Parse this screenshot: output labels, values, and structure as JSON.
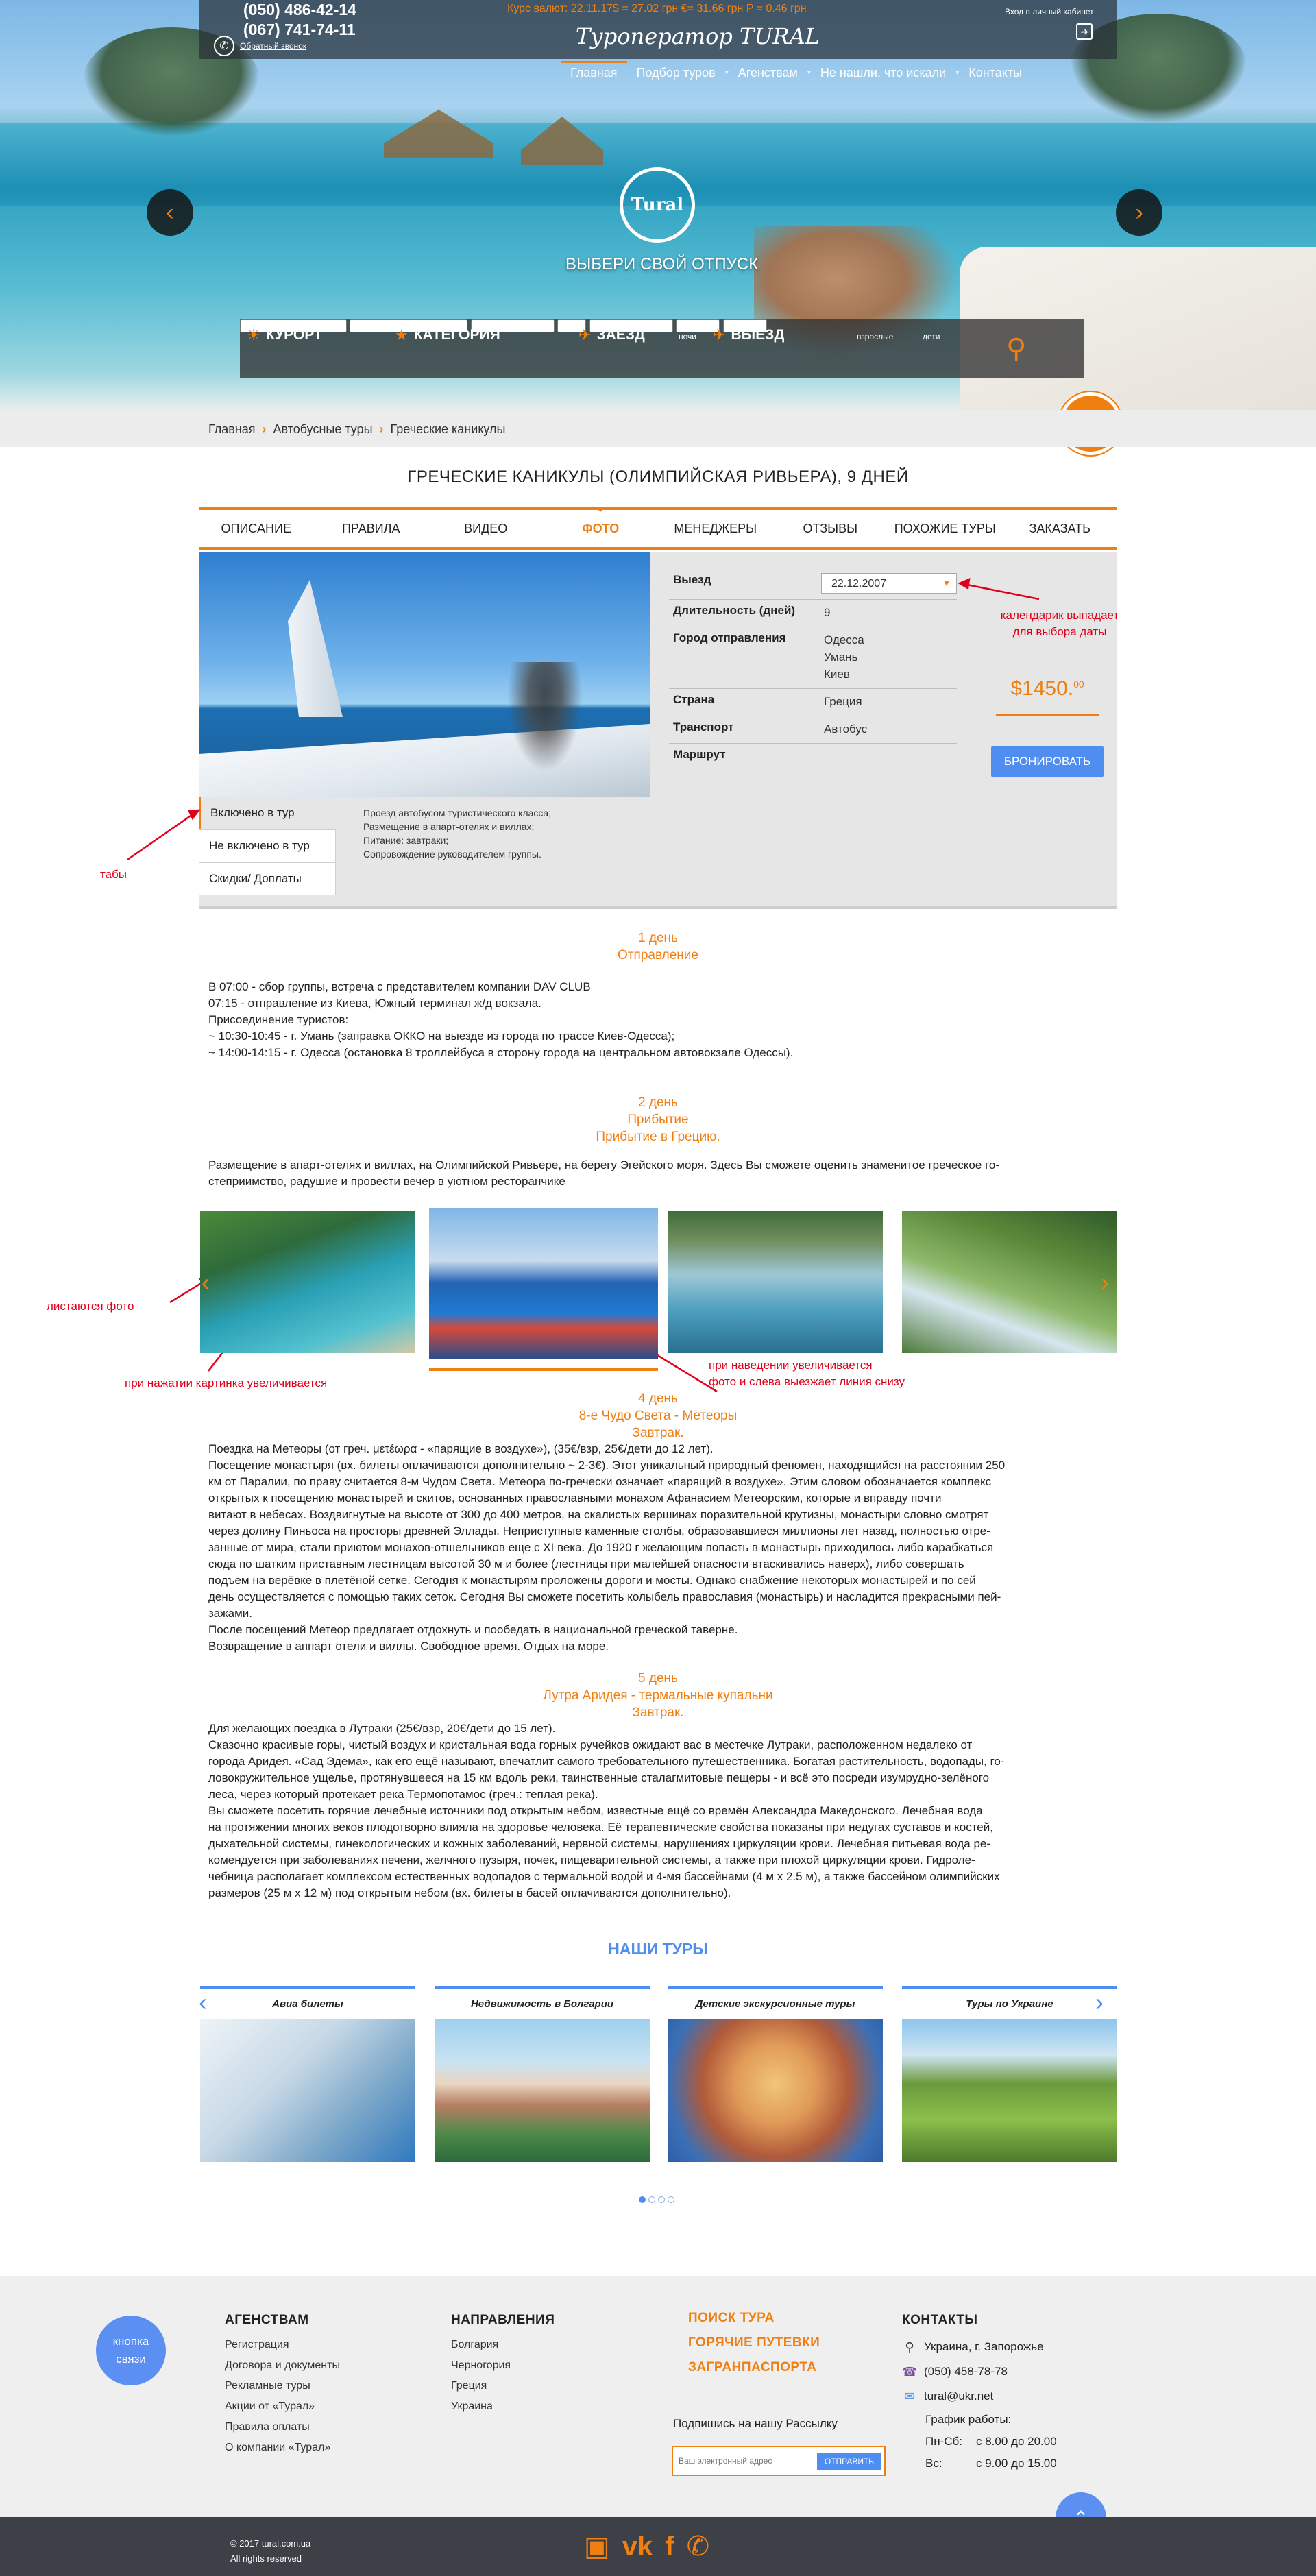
{
  "header": {
    "phones": [
      "(050) 486-42-14",
      "(067) 741-74-11"
    ],
    "callback_label": "Обратный звонок",
    "rate": "Курс валют: 22.11.17$ = 27.02 грн €= 31.66 грн P = 0.46 грн",
    "brand": "Туроператор TURAL",
    "login": "Вход в личный кабинет",
    "login_icon": "exit-icon",
    "nav": [
      "Главная",
      "Подбор туров",
      "Агенствам",
      "Не нашли, что искали",
      "Контакты"
    ],
    "active_nav": "Главная"
  },
  "hero": {
    "logo_text": "Tural",
    "slogan": "ВЫБЕРИ СВОЙ ОТПУСК",
    "prev_icon": "chevron-left-icon",
    "next_icon": "chevron-right-icon"
  },
  "search": {
    "resort": "КУРОРТ",
    "category": "КАТЕГОРИЯ",
    "checkin": "ЗАЕЗД",
    "nights": "ночи",
    "checkout": "ВЫЕЗД",
    "adults": "взрослые",
    "children": "дети",
    "search_icon": "search-icon"
  },
  "breadcrumb": [
    "Главная",
    "Автобусные туры",
    "Греческие каникулы"
  ],
  "tour": {
    "title": "ГРЕЧЕСКИЕ КАНИКУЛЫ (ОЛИМПИЙСКАЯ РИВЬЕРА), 9 ДНЕЙ",
    "tabs": [
      "ОПИСАНИЕ",
      "ПРАВИЛА",
      "ВИДЕО",
      "ФОТО",
      "МЕНЕДЖЕРЫ",
      "ОТЗЫВЫ",
      "ПОХОЖИЕ ТУРЫ",
      "ЗАКАЗАТЬ"
    ],
    "active_tab": "ФОТО",
    "specs": {
      "departure_label": "Выезд",
      "departure_value": "22.12.2007",
      "duration_label": "Длительность (дней)",
      "duration_value": "9",
      "city_label": "Город отправления",
      "city_values": [
        "Одесса",
        "Умань",
        "Киев"
      ],
      "country_label": "Страна",
      "country_value": "Греция",
      "transport_label": "Транспорт",
      "transport_value": "Автобус",
      "route_label": "Маршрут"
    },
    "price": "$1450.",
    "price_cents": "00",
    "book_label": "БРОНИРОВАТЬ",
    "side_tabs": [
      "Включено в тур",
      "Не включено в тур",
      "Скидки/ Доплаты"
    ],
    "included": [
      "Проезд автобусом туристического класса;",
      "Размещение в апарт-отелях и виллах;",
      "Питание: завтраки;",
      "Сопровождение руководителем группы."
    ]
  },
  "program": {
    "day1_head": [
      "1 день",
      "Отправление"
    ],
    "day1_text": [
      "В 07:00 - сбор группы, встреча с представителем компании DAV CLUB",
      "07:15 - отправление из Киева, Южный терминал ж/д вокзала.",
      "Присоединение туристов:",
      "~ 10:30-10:45 - г. Умань  (заправка ОККО на выезде из города по трассе Киев-Одесса);",
      "~ 14:00-14:15 - г. Одесса (остановка 8 троллейбуса в сторону города на центральном автовокзале Одессы)."
    ],
    "day2_head": [
      "2 день",
      "Прибытие",
      "Прибытие в Грецию."
    ],
    "day2_text": [
      "Размещение в апарт-отелях и виллах, на Олимпийской Ривьере, на берегу Эгейского моря. Здесь Вы сможете оценить знаменитое греческое го-",
      "степриимство, радушие и провести вечер в уютном ресторанчике"
    ],
    "day4_head": [
      "4 день",
      "8-е Чудо Света - Метеоры",
      "Завтрак."
    ],
    "day4_text": [
      "Поездка на Метеоры (от греч. μετέωρα - «парящие в воздухе»), (35€/взр, 25€/дети до 12 лет).",
      "Посещение монастыря (вх. билеты оплачиваются дополнительно ~ 2-3€). Этот уникальный природный феномен, находящийся на расстоянии 250",
      "км от Паралии, по праву считается 8-м Чудом Света. Метеора по-гречески означает «парящий в воздухе». Этим словом обозначается комплекс",
      "открытых к посещению монастырей и скитов, основанных православными монахом Афанасием Метеорским, которые и вправду почти",
      "витают в небесах. Воздвигнутые на высоте от 300 до 400 метров, на скалистых вершинах поразительной крутизны, монастыри словно смотрят",
      "через долину Пиньоса на просторы древней Эллады. Неприступные каменные столбы, образовавшиеся миллионы лет назад, полностью отре-",
      "занные от мира, стали приютом монахов-отшельников еще с XI века. До 1920 г желающим попасть в монастырь приходилось либо карабкаться",
      "сюда по шатким приставным лестницам высотой 30 м и более (лестницы при малейшей опасности втаскивались наверх), либо совершать",
      "подъем на верёвке в плетёной сетке. Сегодня к монастырям проложены дороги и мосты. Однако снабжение некоторых монастырей и по сей",
      "день осуществляется с помощью таких сеток. Сегодня Вы сможете посетить колыбель православия (монастырь) и насладится прекрасными пей-",
      "зажами.",
      "После посещений Метеор предлагает отдохнуть и пообедать в национальной греческой таверне.",
      "Возвращение в аппарт отели и виллы. Свободное время. Отдых на море."
    ],
    "day5_head": [
      "5 день",
      "Лутра Аридея - термальные купальни",
      "Завтрак."
    ],
    "day5_text": [
      "Для желающих поездка в Лутраки (25€/взр, 20€/дети до 15 лет).",
      "Сказочно красивые горы, чистый воздух и кристальная вода горных ручейков ожидают вас в местечке Лутраки, расположенном недалеко от",
      "города Аридея. «Сад Эдема», как его ещё называют, впечатлит самого требовательного путешественника. Богатая растительность, водопады, го-",
      "ловокружительное ущелье, протянувшееся на 15 км вдоль реки, таинственные сталагмитовые пещеры - и всё это посреди изумрудно-зелёного",
      "леса, через который протекает река Термопотамос (греч.: теплая река).",
      "Вы сможете посетить  горячие лечебные источники под открытым небом, известные ещё со времён Александра Македонского. Лечебная вода",
      "на протяжении многих веков плодотворно влияла на здоровье человека. Её терапевтические свойства показаны при недугах суставов и костей,",
      "дыхательной системы, гинекологических и кожных заболеваний, нервной системы, нарушениях циркуляции крови. Лечебная питьевая вода ре-",
      "комендуется при заболеваниях печени, желчного пузыря, почек, пищеварительной системы, а также при плохой циркуляции крови. Гидроле-",
      "чебница располагает комплексом естественных водопадов с термальной водой и 4-мя бассейнами (4 м х 2.5 м), а также бассейном олимпийских",
      "размеров (25 м х 12 м) под открытым небом (вх. билеты в басей оплачиваются дополнительно)."
    ]
  },
  "annotations": {
    "calendar": [
      "календарик выпадает",
      "для выбора даты"
    ],
    "tabs": "табы",
    "photos_scroll": "листаются фото",
    "click_zoom": "при нажатии картинка увеличивается",
    "hover": [
      "при наведении увеличивается",
      "фото и слева выезжает линия снизу"
    ]
  },
  "our_tours": {
    "title": "НАШИ ТУРЫ",
    "cards": [
      "Авиа билеты",
      "Недвижимость в Болгарии",
      "Детские экскурсионные туры",
      "Туры по Украине"
    ]
  },
  "footer": {
    "contact_bubble": [
      "кнопка",
      "связи"
    ],
    "agents_title": "АГЕНСТВАМ",
    "agents_links": [
      "Регистрация",
      "Договора и документы",
      "Рекламные туры",
      "Акции от «Турал»",
      "Правила оплаты",
      "О компании «Турал»"
    ],
    "directions_title": "НАПРАВЛЕНИЯ",
    "directions_links": [
      "Болгария",
      "Черногория",
      "Греция",
      "Украина"
    ],
    "orange_links": [
      "ПОИСК ТУРА",
      "ГОРЯЧИЕ ПУТЕВКИ",
      "ЗАГРАНПАСПОРТА"
    ],
    "subscribe_label": "Подпишись на нашу Рассылку",
    "subscribe_placeholder": "Ваш электронный адрес",
    "subscribe_button": "ОТПРАВИТЬ",
    "contacts_title": "КОНТАКТЫ",
    "address": "Украина, г. Запорожье",
    "phone": "(050) 458-78-78",
    "email": "tural@ukr.net",
    "hours_title": "График работы:",
    "hours": [
      {
        "days": "Пн-Сб:",
        "time": "с 8.00 до 20.00"
      },
      {
        "days": "Вс:",
        "time": "с 9.00 до 15.00"
      }
    ],
    "copyright": [
      "© 2017 tural.com.ua",
      "All rights reserved"
    ],
    "socials": [
      "instagram-icon",
      "vk-icon",
      "facebook-icon",
      "phone-icon"
    ]
  },
  "colors": {
    "accent": "#f07f12",
    "blue": "#4f8ef0",
    "annotation": "#e0001b"
  }
}
